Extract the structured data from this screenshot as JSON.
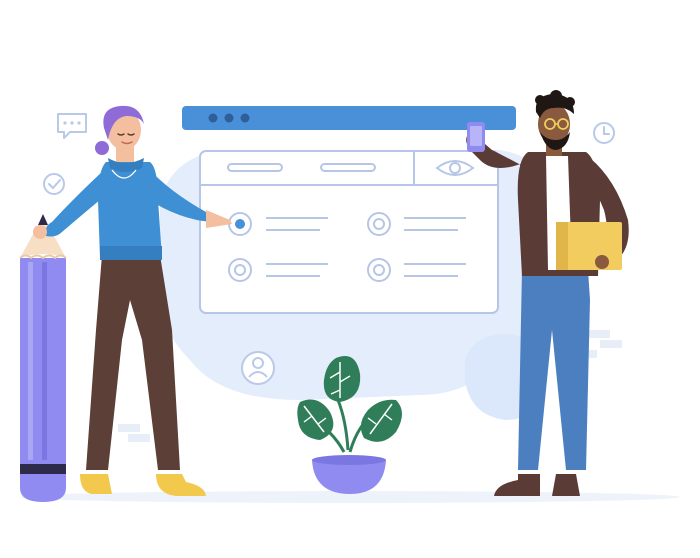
{
  "illustration": {
    "window": {
      "titlebar_dots": 3,
      "checked_option_index": 0,
      "option_count": 4
    },
    "icons": [
      "chat-bubble-icon",
      "check-circle-icon",
      "clock-icon",
      "eye-icon",
      "user-icon",
      "phone-icon",
      "pencil-icon",
      "folder-icon",
      "plant-icon"
    ],
    "colors": {
      "primary_blue": "#4a90d9",
      "light_blue": "#dbe8fb",
      "window_border": "#b7c6e6",
      "sweater": "#3e8fd3",
      "pants": "#5c3f37",
      "pencil": "#8f8bf0",
      "jacket": "#5b3b36",
      "jeans": "#4c7fc0",
      "folder": "#f2cc5e",
      "leaf_green": "#2f7e59",
      "pot": "#8f8bf0"
    }
  }
}
